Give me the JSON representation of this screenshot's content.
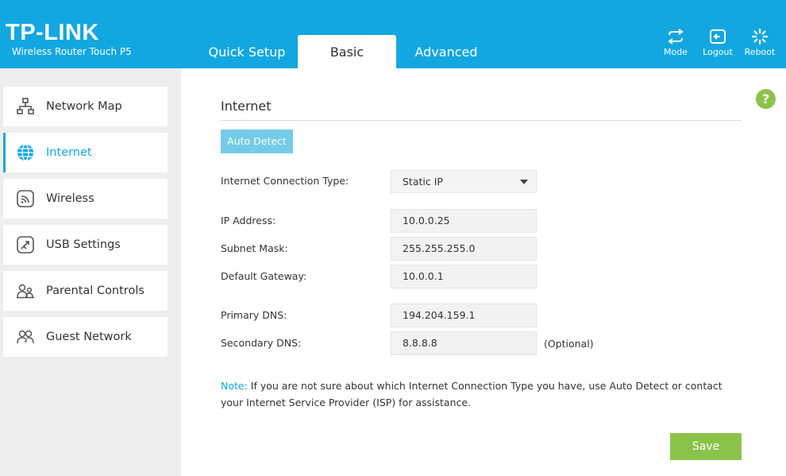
{
  "header": {
    "logo": "TP-LINK",
    "model": "Wireless Router Touch P5",
    "tabs": [
      {
        "label": "Quick Setup"
      },
      {
        "label": "Basic"
      },
      {
        "label": "Advanced"
      }
    ],
    "buttons": [
      {
        "label": "Mode",
        "icon": "mode-icon"
      },
      {
        "label": "Logout",
        "icon": "logout-icon"
      },
      {
        "label": "Reboot",
        "icon": "reboot-icon"
      }
    ]
  },
  "sidebar": {
    "items": [
      {
        "label": "Network Map",
        "icon": "network-map-icon"
      },
      {
        "label": "Internet",
        "icon": "globe-icon"
      },
      {
        "label": "Wireless",
        "icon": "wireless-icon"
      },
      {
        "label": "USB Settings",
        "icon": "usb-icon"
      },
      {
        "label": "Parental Controls",
        "icon": "parental-controls-icon"
      },
      {
        "label": "Guest Network",
        "icon": "guest-network-icon"
      }
    ]
  },
  "main": {
    "title": "Internet",
    "help": "?",
    "auto_detect": "Auto Detect",
    "connection_type_label": "Internet Connection Type:",
    "connection_type_value": "Static IP",
    "ip_label": "IP Address:",
    "ip_value": "10.0.0.25",
    "subnet_label": "Subnet Mask:",
    "subnet_value": "255.255.255.0",
    "gateway_label": "Default Gateway:",
    "gateway_value": "10.0.0.1",
    "primary_dns_label": "Primary DNS:",
    "primary_dns_value": "194.204.159.1",
    "secondary_dns_label": "Secondary DNS:",
    "secondary_dns_value": "8.8.8.8",
    "optional": "(Optional)",
    "note_label": "Note:",
    "note_text": "If you are not sure about which Internet Connection Type you have, use Auto Detect or contact your Internet Service Provider (ISP) for assistance.",
    "save": "Save"
  },
  "colors": {
    "brand": "#12a7e1",
    "auto_detect_bg": "#74cbe8",
    "save_bg": "#8bc34a",
    "sidebar_bg": "#eeeeee"
  }
}
